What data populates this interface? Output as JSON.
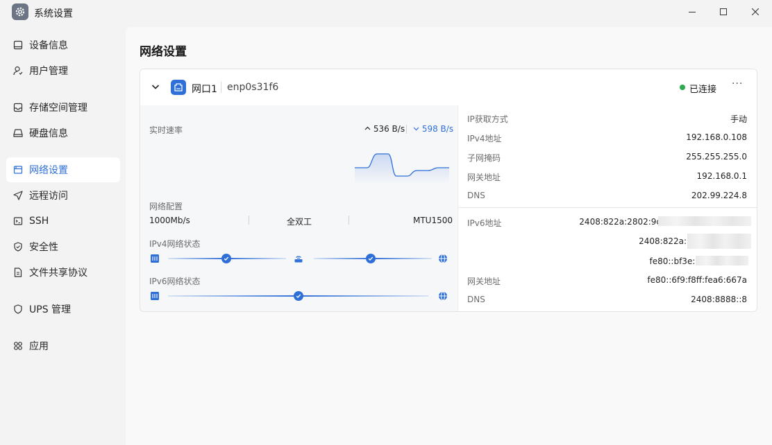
{
  "window": {
    "title": "系统设置",
    "icon": "gear-icon",
    "controls": [
      "minimize-icon",
      "maximize-icon",
      "close-icon"
    ]
  },
  "sidebar": {
    "items": [
      {
        "label": "设备信息",
        "icon": "device-icon",
        "active": false
      },
      {
        "label": "用户管理",
        "icon": "user-icon",
        "active": false
      },
      {
        "label": "存储空间管理",
        "icon": "storage-icon",
        "active": false
      },
      {
        "label": "硬盘信息",
        "icon": "disk-icon",
        "active": false
      },
      {
        "label": "网络设置",
        "icon": "network-icon",
        "active": true
      },
      {
        "label": "远程访问",
        "icon": "send-icon",
        "active": false
      },
      {
        "label": "SSH",
        "icon": "terminal-icon",
        "active": false
      },
      {
        "label": "安全性",
        "icon": "shield-icon",
        "active": false
      },
      {
        "label": "文件共享协议",
        "icon": "file-icon",
        "active": false
      },
      {
        "label": "UPS 管理",
        "icon": "ups-shield-icon",
        "active": false
      },
      {
        "label": "应用",
        "icon": "apps-icon",
        "active": false
      }
    ]
  },
  "main": {
    "title": "网络设置",
    "port": {
      "name": "网口1",
      "device": "enp0s31f6",
      "status": "已连接",
      "status_color": "#2fa84f",
      "more": "···",
      "realtime_label": "实时速率",
      "upload": "536 B/s",
      "download": "598 B/s",
      "config_label": "网络配置",
      "speed": "1000Mb/s",
      "duplex": "全双工",
      "mtu": "MTU1500",
      "ipv4_status_label": "IPv4网络状态",
      "ipv6_status_label": "IPv6网络状态"
    },
    "ipv4": {
      "method_label": "IP获取方式",
      "method": "手动",
      "addr_label": "IPv4地址",
      "addr": "192.168.0.108",
      "mask_label": "子网掩码",
      "mask": "255.255.255.0",
      "gateway_label": "网关地址",
      "gateway": "192.168.0.1",
      "dns_label": "DNS",
      "dns": "202.99.224.8"
    },
    "ipv6": {
      "addr_label": "IPv6地址",
      "addr1": "2408:822a:2802:9c",
      "addr2": "2408:822a:",
      "addr3": "fe80::bf3e:6",
      "gateway_label": "网关地址",
      "gateway": "fe80::6f9:f8ff:fea6:667a",
      "dns_label": "DNS",
      "dns": "2408:8888::8"
    }
  },
  "colors": {
    "accent": "#2e6fd8",
    "connected": "#2fa84f"
  }
}
